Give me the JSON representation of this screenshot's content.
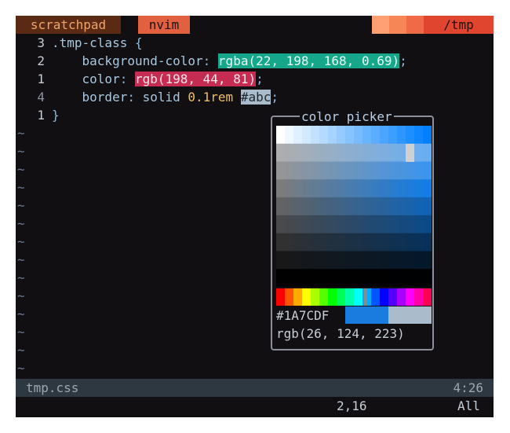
{
  "tabline": {
    "tab_active": "scratchpad",
    "tab_mode": "nvim",
    "cwd": "/tmp",
    "swatches": [
      "#fea074",
      "#f68656",
      "#ef6b48"
    ]
  },
  "editor": {
    "lines": [
      {
        "number": "3",
        "dim": false,
        "parts": [
          {
            "t": ".tmp-class ",
            "c": "prop"
          },
          {
            "t": "{",
            "c": "punc"
          }
        ]
      },
      {
        "number": "2",
        "dim": false,
        "parts": [
          {
            "t": "    background-color",
            "c": "prop"
          },
          {
            "t": ": ",
            "c": "punc"
          },
          {
            "t": "rgba(22, 198, 168, 0.69)",
            "c": "hl-green"
          },
          {
            "t": ";",
            "c": "punc"
          }
        ]
      },
      {
        "number": "1",
        "dim": false,
        "parts": [
          {
            "t": "    color",
            "c": "prop"
          },
          {
            "t": ": ",
            "c": "punc"
          },
          {
            "t": "rgb(198, 44, 81)",
            "c": "hl-red"
          },
          {
            "t": ";",
            "c": "punc"
          }
        ]
      },
      {
        "number": "4",
        "dim": true,
        "parts": [
          {
            "t": "    border",
            "c": "prop"
          },
          {
            "t": ": ",
            "c": "punc"
          },
          {
            "t": "solid ",
            "c": "prop"
          },
          {
            "t": "0.1rem",
            "c": "num"
          },
          {
            "t": " ",
            "c": "prop"
          },
          {
            "t": "#abc",
            "c": "hl-gray"
          },
          {
            "t": ";",
            "c": "punc"
          }
        ]
      },
      {
        "number": "1",
        "dim": false,
        "parts": [
          {
            "t": "}",
            "c": "punc"
          }
        ]
      }
    ],
    "tilde": "~",
    "tilde_count": 14
  },
  "color_picker": {
    "title": "color picker",
    "hex": "#1A7CDF",
    "rgb": "rgb(26, 124, 223)",
    "selected_color": "#1a7cdf",
    "original_color": "#aabbcc"
  },
  "statusline": {
    "filename": "tmp.css",
    "position": "4:26"
  },
  "cmdline": {
    "ruler": "2,16",
    "scroll": "All"
  }
}
